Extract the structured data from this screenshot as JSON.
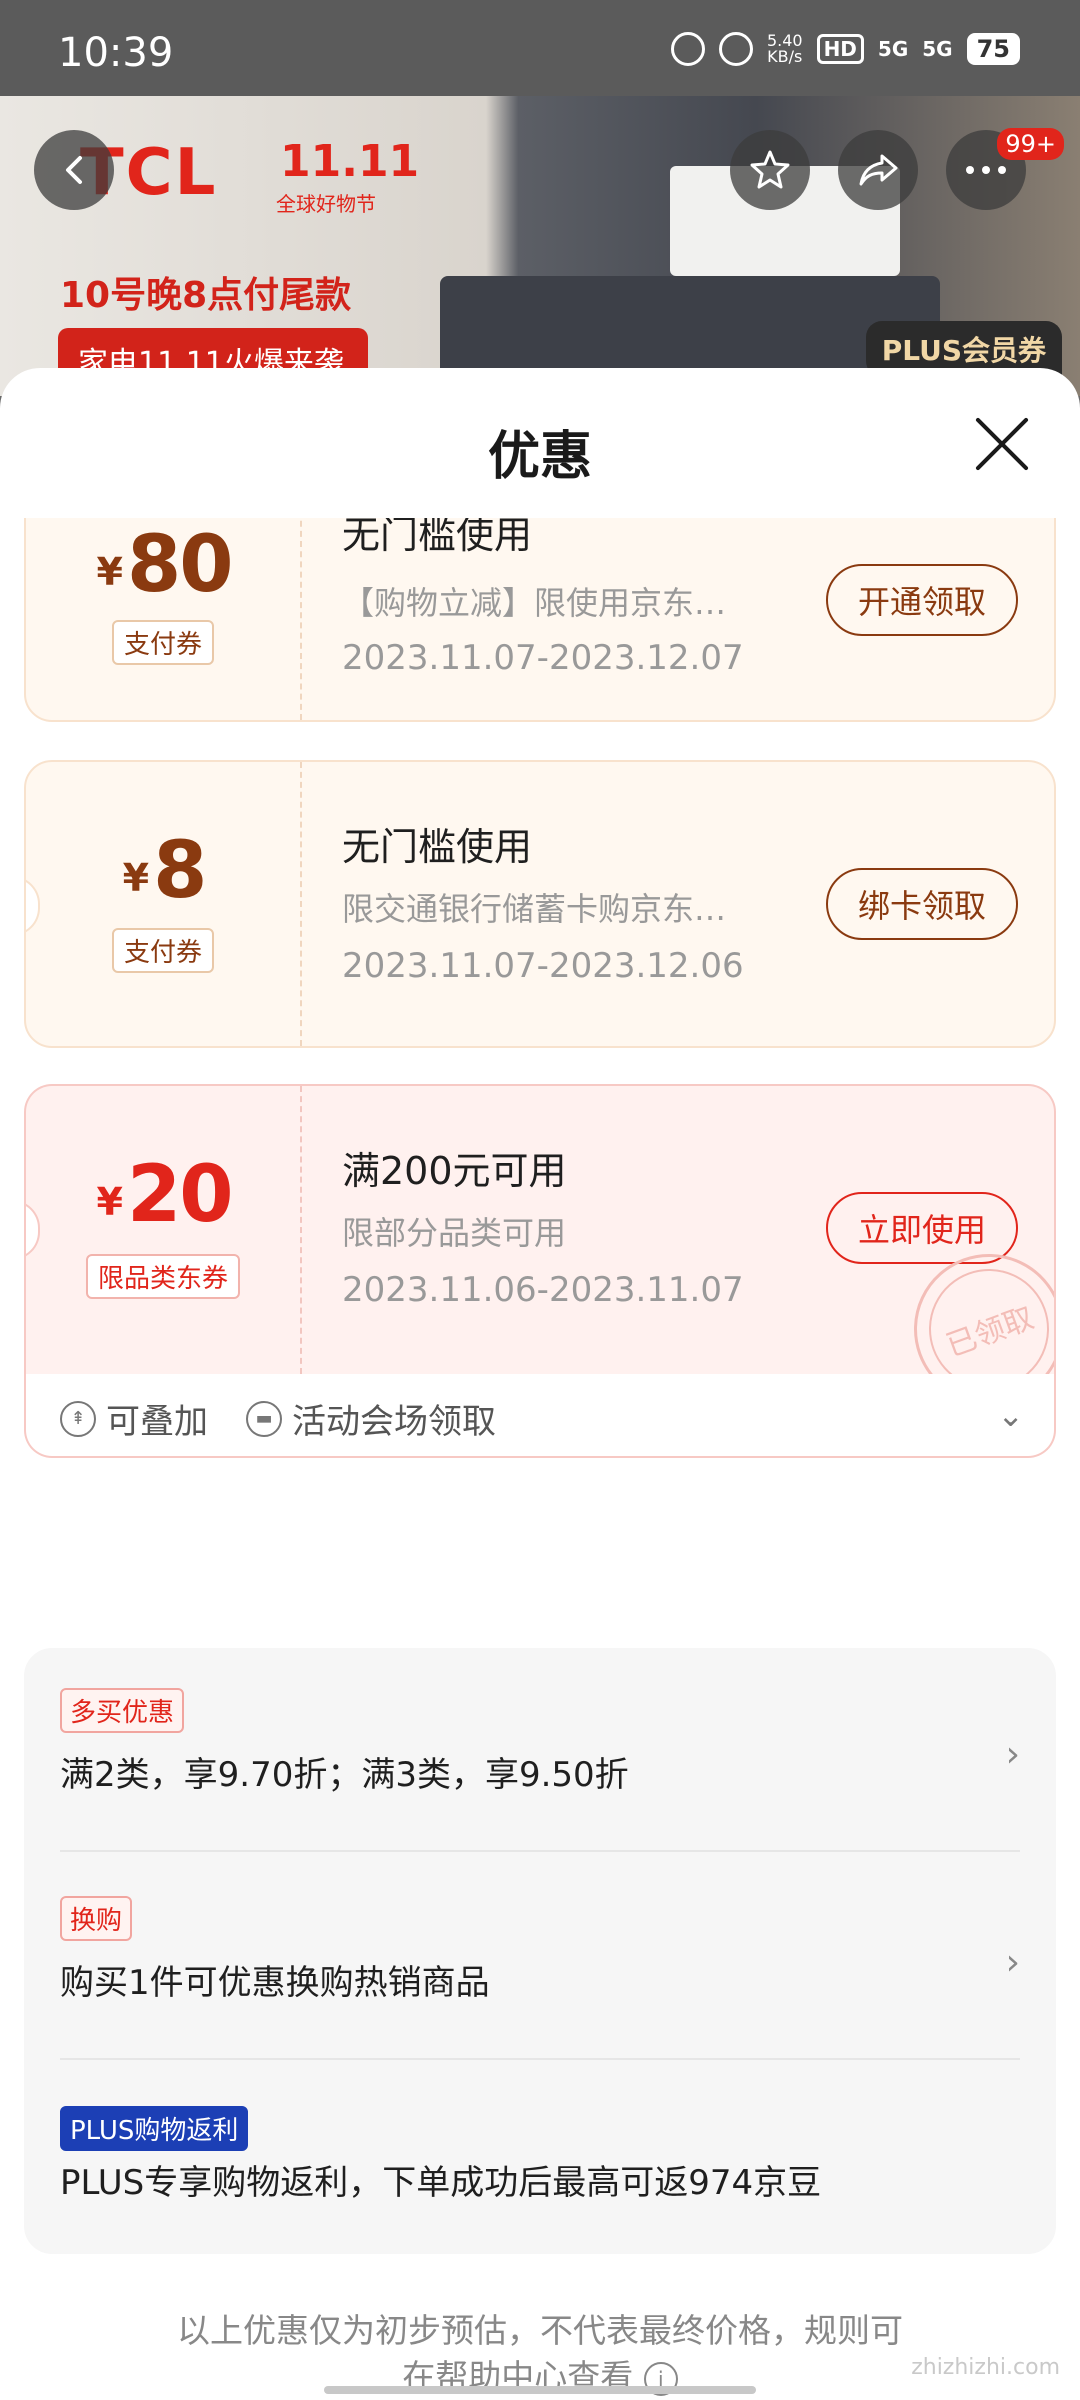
{
  "status_bar": {
    "time": "10:39",
    "net_speed": "5.40",
    "net_unit": "KB/s",
    "hd": "HD",
    "sig1": "5G",
    "sig2": "5G",
    "battery": "75"
  },
  "banner": {
    "brand": "TCL",
    "double11": "11.11",
    "double11_sub": "全球好物节",
    "tail_text": "10号晚8点付尾款",
    "hot_text": "家电11.11火爆来袭",
    "plus_badge": "PLUS会员券",
    "cart_badge": "99+"
  },
  "sheet": {
    "title": "优惠"
  },
  "coupons": [
    {
      "currency": "¥",
      "amount": "80",
      "tag": "支付券",
      "title": "无门槛使用",
      "desc": "【购物立减】限使用京东…",
      "date": "2023.11.07-2023.12.07",
      "button": "开通领取"
    },
    {
      "currency": "¥",
      "amount": "8",
      "tag": "支付券",
      "title": "无门槛使用",
      "desc": "限交通银行储蓄卡购京东…",
      "date": "2023.11.07-2023.12.06",
      "button": "绑卡领取"
    },
    {
      "currency": "¥",
      "amount": "20",
      "tag": "限品类东券",
      "title": "满200元可用",
      "desc": "限部分品类可用",
      "date": "2023.11.06-2023.11.07",
      "button": "立即使用",
      "stamp": "已领取",
      "footer": {
        "stackable": "可叠加",
        "source": "活动会场领取"
      }
    }
  ],
  "promotions": [
    {
      "tag": "多买优惠",
      "text": "满2类，享9.70折；满3类，享9.50折"
    },
    {
      "tag": "换购",
      "text": "购买1件可优惠换购热销商品"
    },
    {
      "tag": "PLUS购物返利",
      "text": "PLUS专享购物返利，下单成功后最高可返974京豆"
    }
  ],
  "disclaimer": {
    "line1": "以上优惠仅为初步预估，不代表最终价格，规则可",
    "line2": "在帮助中心查看"
  },
  "watermark": "zhizhizhi.com",
  "colors": {
    "accent_brown": "#8a3a10",
    "accent_red": "#e1251b",
    "plus_blue": "#1c3fb5"
  }
}
